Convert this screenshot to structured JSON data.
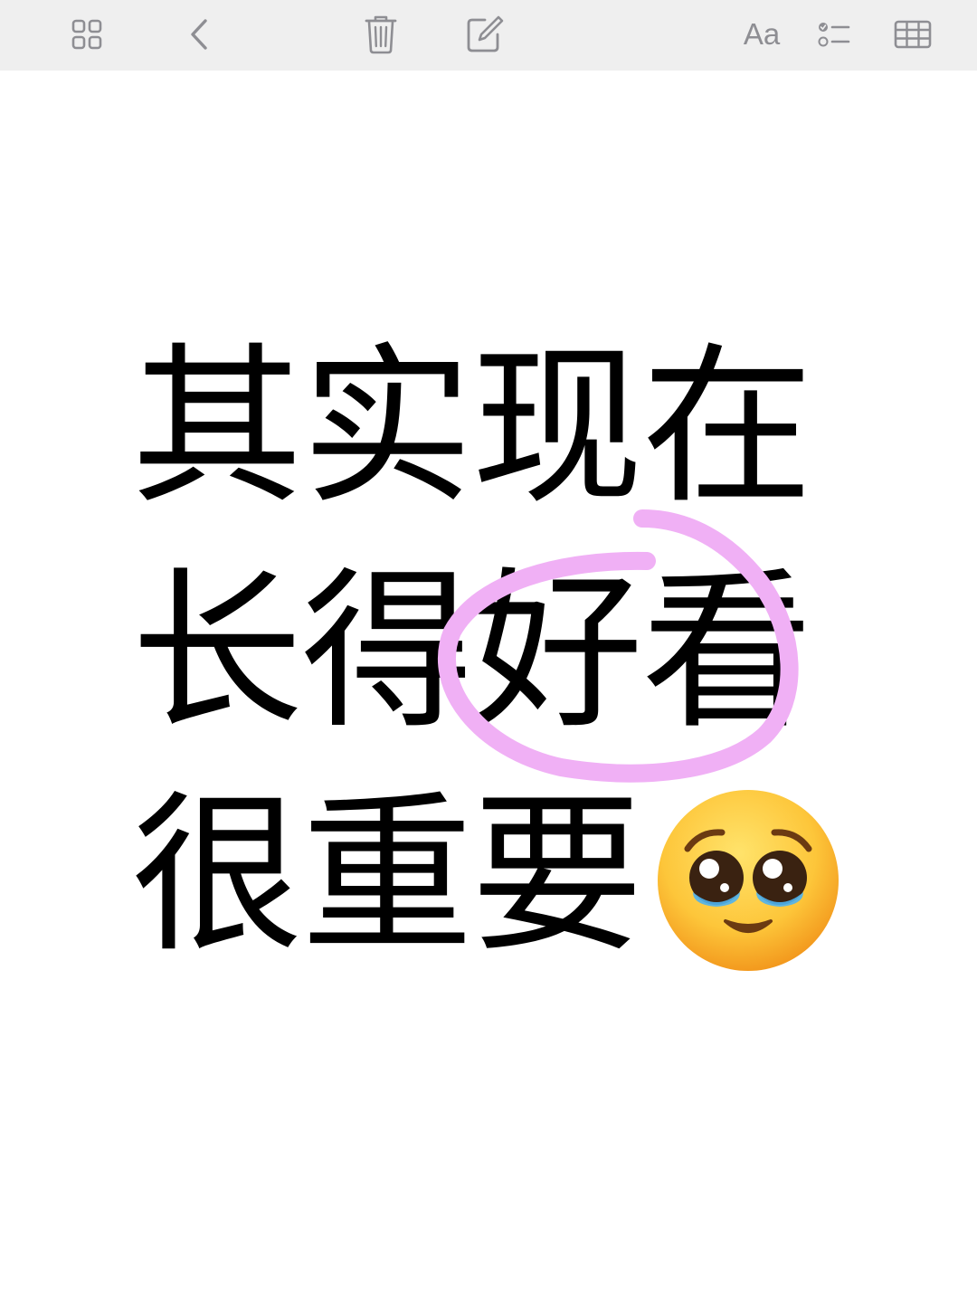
{
  "toolbar": {
    "icons": [
      {
        "name": "gallery-grid-icon"
      },
      {
        "name": "back-chevron-icon"
      },
      {
        "name": "trash-icon"
      },
      {
        "name": "compose-icon"
      },
      {
        "name": "format-text-icon",
        "label": "Aa"
      },
      {
        "name": "checklist-icon"
      },
      {
        "name": "table-icon"
      }
    ],
    "icon_color": "#8e8e93",
    "background": "#efefef"
  },
  "note": {
    "lines": [
      "其实现在",
      "长得好看",
      "很重要"
    ],
    "emoji": "pleading-face",
    "highlight_color": "#f0b0f5"
  }
}
